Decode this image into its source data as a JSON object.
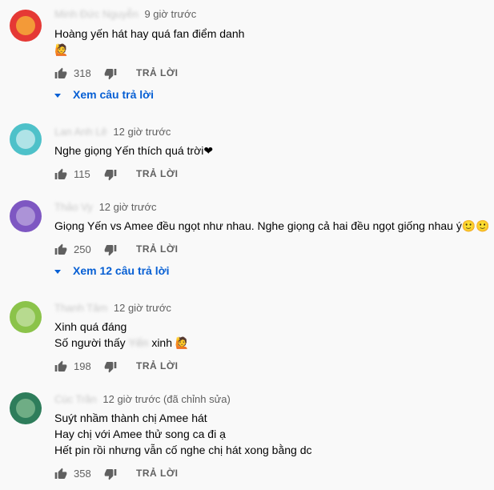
{
  "colors": {
    "background": "#f9f9f9",
    "link": "#065fd4",
    "meta": "#606060",
    "text": "#030303"
  },
  "reply_label": "TRẢ LỜI",
  "comments": [
    {
      "author": "Minh Đức Nguyễn",
      "time": "9 giờ trước",
      "avatar_color": "#e53935",
      "lines": [
        "Hoàng yến hát hay quá fan điểm danh",
        "🙋"
      ],
      "likes": "318",
      "view_replies": "Xem câu trả lời"
    },
    {
      "author": "Lan Anh Lê",
      "time": "12 giờ trước",
      "avatar_color": "#4ec1c9",
      "lines": [
        "Nghe giọng Yến thích quá trời❤"
      ],
      "likes": "115"
    },
    {
      "author": "Thảo Vy",
      "time": "12 giờ trước",
      "avatar_color": "#7e57c2",
      "lines": [
        "Giọng Yến vs Amee đều ngọt như nhau. Nghe giọng cả hai đều ngọt giống nhau ý🙂🙂"
      ],
      "likes": "250",
      "view_replies": "Xem 12 câu trả lời"
    },
    {
      "author": "Thanh Tâm",
      "time": "12 giờ trước",
      "avatar_color": "#8bc34a",
      "lines": [
        "Xinh quá đáng"
      ],
      "line2_prefix": "Số người thấy",
      "line2_blur": "Yến",
      "line2_suffix": "xinh 🙋",
      "likes": "198"
    },
    {
      "author": "Cúc Trần",
      "time": "12 giờ trước (đã chỉnh sửa)",
      "avatar_color": "#2e7d5b",
      "lines": [
        "Suýt nhầm thành chị Amee hát",
        "Hay chị với Amee thử song ca đi ạ",
        "Hết pin rồi nhưng vẫn cố nghe chị hát xong bằng dc"
      ],
      "likes": "358"
    }
  ]
}
